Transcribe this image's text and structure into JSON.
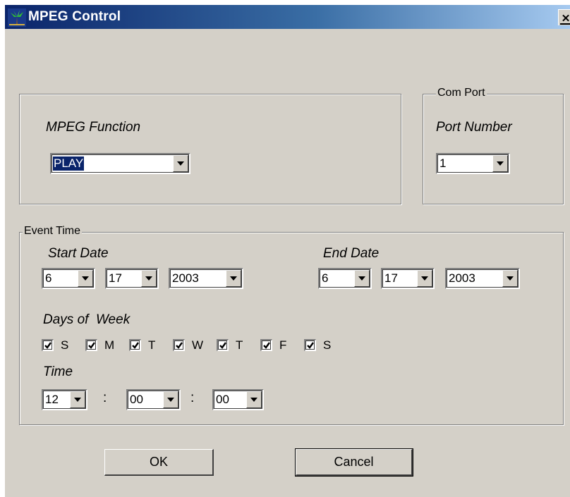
{
  "window": {
    "title": "MPEG Control",
    "close_glyph": "✕"
  },
  "mpeg": {
    "label": "MPEG Function",
    "value": "PLAY"
  },
  "com_port": {
    "legend": "Com Port",
    "label": "Port Number",
    "value": "1"
  },
  "event_time": {
    "legend": "Event Time",
    "start_date": {
      "label": "Start Date",
      "month": "6",
      "day": "17",
      "year": "2003"
    },
    "end_date": {
      "label": "End Date",
      "month": "6",
      "day": "17",
      "year": "2003"
    },
    "days_label": "Days of  Week",
    "days": [
      {
        "letter": "S",
        "checked": true
      },
      {
        "letter": "M",
        "checked": true
      },
      {
        "letter": "T",
        "checked": true
      },
      {
        "letter": "W",
        "checked": true
      },
      {
        "letter": "T",
        "checked": true
      },
      {
        "letter": "F",
        "checked": true
      },
      {
        "letter": "S",
        "checked": true
      }
    ],
    "time_label": "Time",
    "time": {
      "hour": "12",
      "minute": "00",
      "second": "00",
      "separator": ":"
    }
  },
  "buttons": {
    "ok": "OK",
    "cancel": "Cancel"
  },
  "colors": {
    "face": "#d4d0c8",
    "title_start": "#0a246a",
    "title_end": "#a6caf0",
    "selection": "#0a246a"
  },
  "icons": {
    "app": "palm-tree-icon",
    "close": "close-icon",
    "dropdown": "chevron-down-icon",
    "check": "checkmark-icon"
  }
}
